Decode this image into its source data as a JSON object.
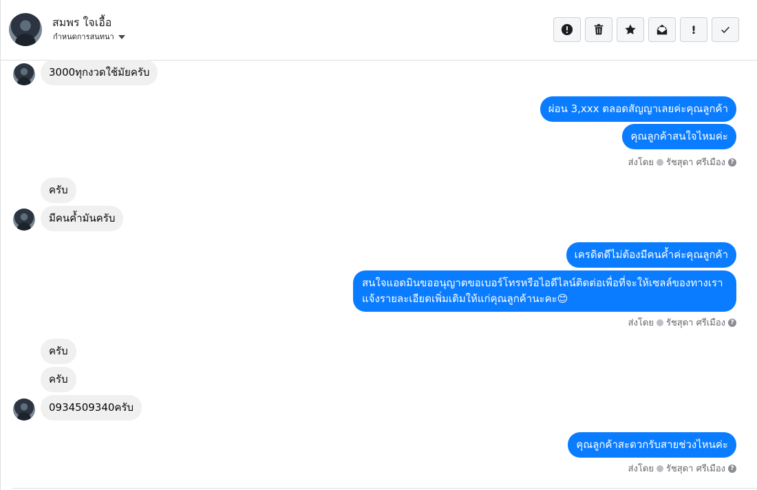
{
  "header": {
    "name": "สมพร ใจเอื้อ",
    "assign_label": "กำหนดการสนทนา",
    "actions": [
      {
        "icon": "alert-icon"
      },
      {
        "icon": "trash-icon"
      },
      {
        "icon": "star-icon"
      },
      {
        "icon": "mail-icon"
      },
      {
        "icon": "exclamation-icon",
        "label": "!"
      },
      {
        "icon": "check-icon"
      }
    ]
  },
  "messages": {
    "m1": "3000ทุกงวดใช้มัยครับ",
    "m2": "ผ่อน 3,xxx ตลอดสัญญาเลยค่ะคุณลูกค้า",
    "m3": "คุณลูกค้าสนใจไหมค่ะ",
    "m4": "ครับ",
    "m5": "มีคนค้ำมันครับ",
    "m6": "เครดิตดีไม่ต้องมีคนค้ำค่ะคุณลูกค้า",
    "m7_line1": "สนใจแอดมินขออนุญาตขอเบอร์โทรหรือไอดีไลน์ติดต่อเพื่อที่จะให้เซลล์ของทางเรา",
    "m7_line2": "แจ้งรายละเอียดเพิ่มเติมให้แก่คุณลูกค้านะคะ😊",
    "m8": "ครับ",
    "m9": "ครับ",
    "m10": "0934509340ครับ",
    "m11": "คุณลูกค้าสะดวกรับสายช่วงไหนค่ะ"
  },
  "sent_by": {
    "prefix": "ส่งโดย",
    "agent": "รัชสุดา ศรีเมือง"
  }
}
